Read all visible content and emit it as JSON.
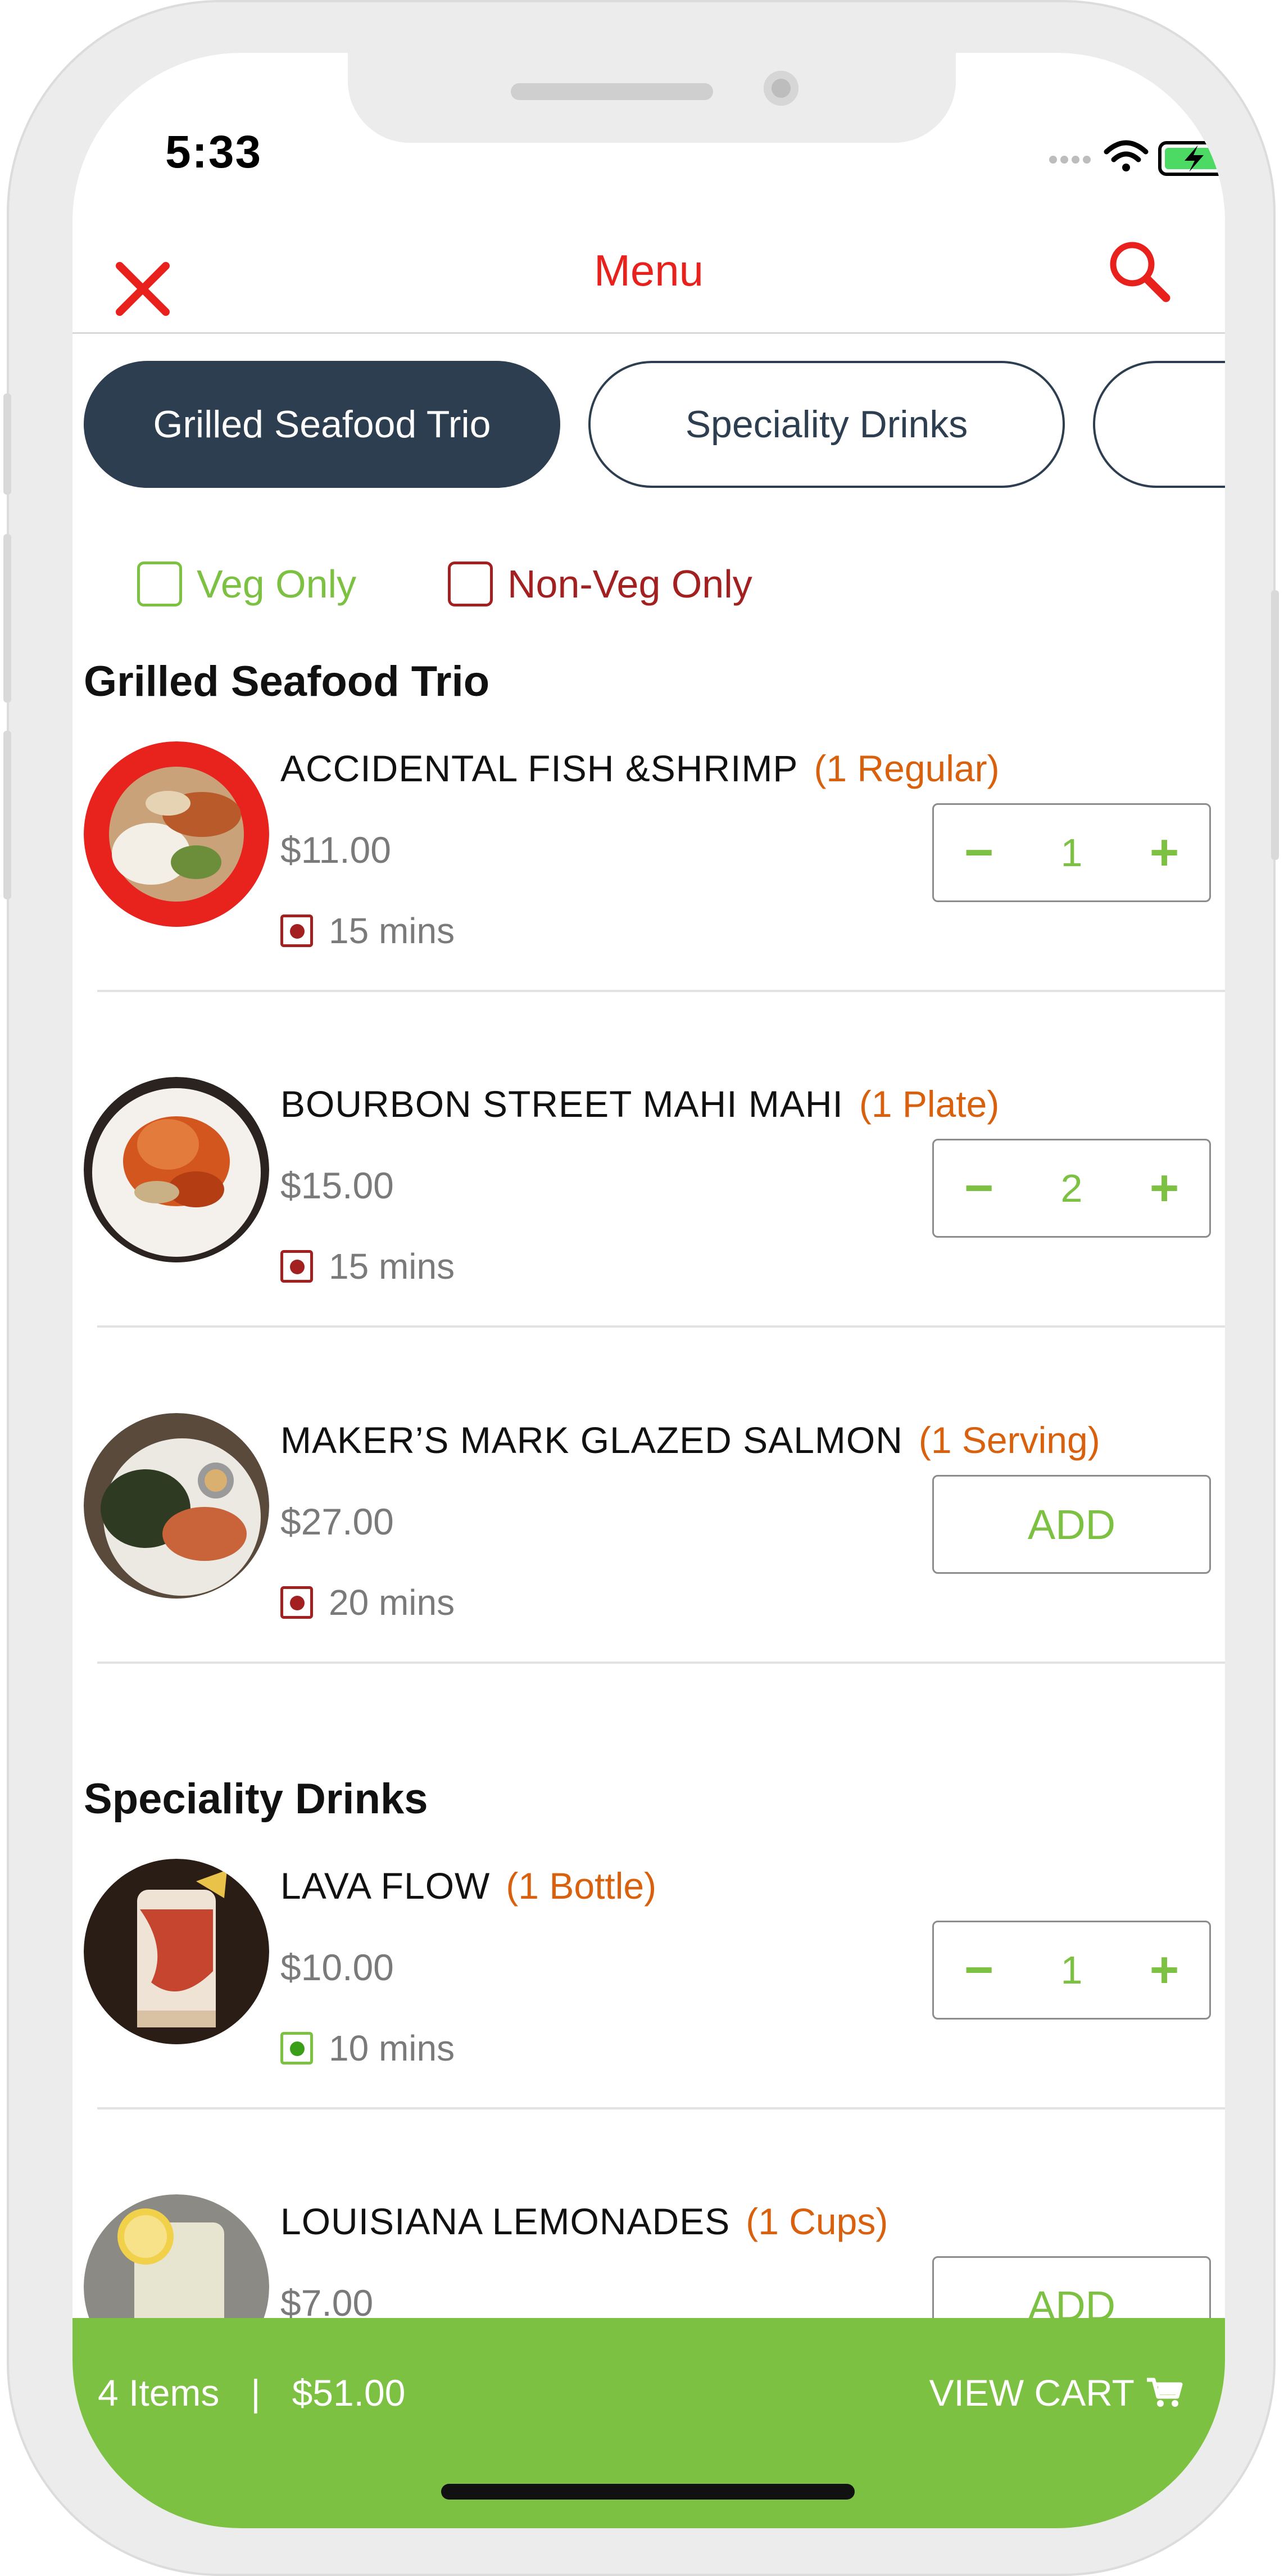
{
  "status_bar": {
    "time": "5:33"
  },
  "header": {
    "title": "Menu",
    "close_icon": "close-icon",
    "search_icon": "search-icon"
  },
  "categories": [
    {
      "label": "Grilled Seafood Trio",
      "active": true
    },
    {
      "label": "Speciality Drinks",
      "active": false
    },
    {
      "label": "",
      "active": false
    }
  ],
  "filters": {
    "veg_label": "Veg Only",
    "nonveg_label": "Non-Veg Only"
  },
  "sections": [
    {
      "title": "Grilled Seafood Trio",
      "items": [
        {
          "name": "ACCIDENTAL FISH &SHRIMP",
          "unit": "(1 Regular)",
          "price": "$11.00",
          "time": "15 mins",
          "diet": "non-veg",
          "quantity": "1",
          "add_label": ""
        },
        {
          "name": "BOURBON STREET MAHI MAHI",
          "unit": "(1 Plate)",
          "price": "$15.00",
          "time": "15 mins",
          "diet": "non-veg",
          "quantity": "2",
          "add_label": ""
        },
        {
          "name": "MAKER’S MARK GLAZED SALMON",
          "unit": "(1 Serving)",
          "price": "$27.00",
          "time": "20 mins",
          "diet": "non-veg",
          "quantity": "",
          "add_label": "ADD"
        }
      ]
    },
    {
      "title": "Speciality Drinks",
      "items": [
        {
          "name": "LAVA FLOW",
          "unit": "(1 Bottle)",
          "price": "$10.00",
          "time": "10 mins",
          "diet": "veg",
          "quantity": "1",
          "add_label": ""
        },
        {
          "name": "LOUISIANA LEMONADES",
          "unit": "(1 Cups)",
          "price": "$7.00",
          "time": "",
          "diet": "veg",
          "quantity": "",
          "add_label": "ADD"
        }
      ]
    }
  ],
  "cart": {
    "items": "4 Items",
    "separator": "|",
    "total": "$51.00",
    "view_label": "VIEW CART",
    "icon": "cart-icon"
  },
  "colors": {
    "accent_red": "#e8211d",
    "green": "#7cc142",
    "navy": "#2c3e50",
    "orange": "#d9600c",
    "nonveg": "#a32020"
  }
}
